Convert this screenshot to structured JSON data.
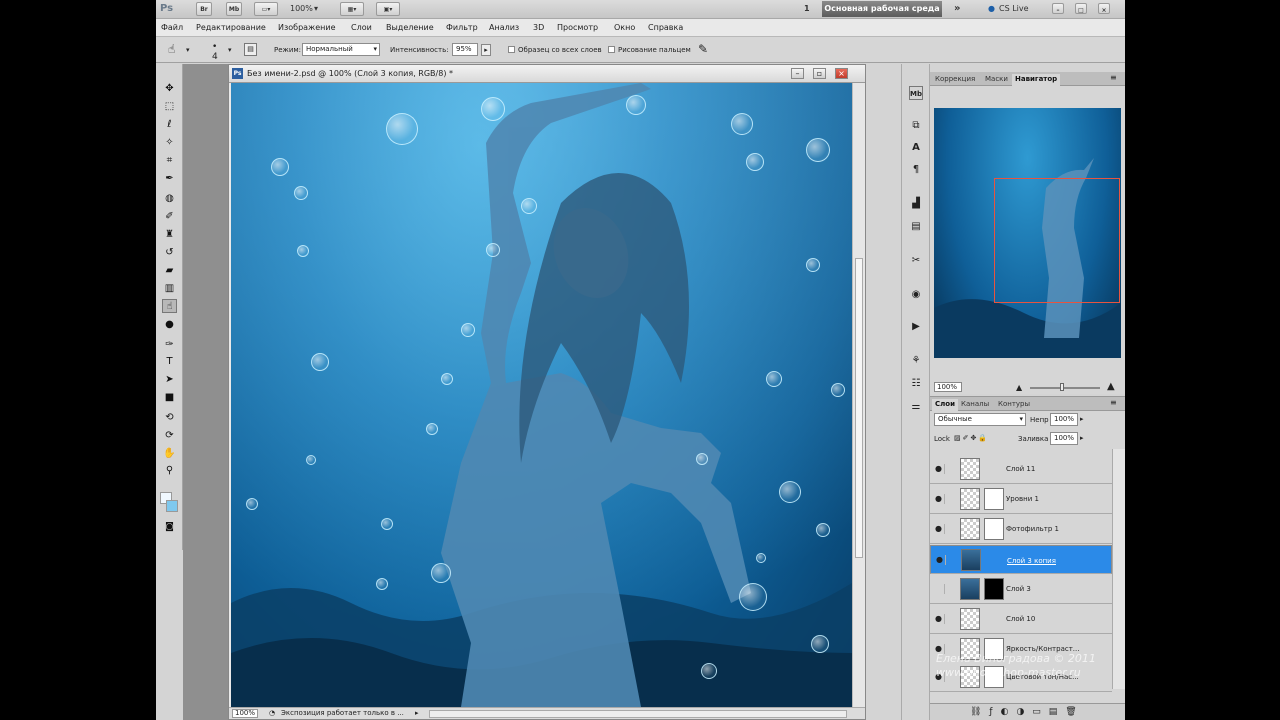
{
  "appbar": {
    "ps_logo": "Ps",
    "br": "Br",
    "mb": "Mb",
    "zoom": "100%",
    "one": "1",
    "workspace": "Основная рабочая среда",
    "cslive": "CS Live"
  },
  "menu": [
    "Файл",
    "Редактирование",
    "Изображение",
    "Слои",
    "Выделение",
    "Фильтр",
    "Анализ",
    "3D",
    "Просмотр",
    "Окно",
    "Справка"
  ],
  "options": {
    "mode_label": "Режим:",
    "mode_value": "Нормальный",
    "intensity_label": "Интенсивность:",
    "intensity_value": "95%",
    "sample_all": "Образец со всех слоев",
    "finger_paint": "Рисование пальцем"
  },
  "document": {
    "title": "Без имени-2.psd @ 100% (Слой 3 копия, RGB/8) *",
    "status_zoom": "100%",
    "status_text": "Экспозиция работает только в ..."
  },
  "panels": {
    "tabs_top": [
      "Коррекция",
      "Маски",
      "Навигатор"
    ],
    "nav_zoom": "100%",
    "tabs_layers": [
      "Слои",
      "Каналы",
      "Контуры"
    ],
    "blend": "Обычные",
    "opacity_label": "Непр",
    "opacity_value": "100%",
    "lock_label": "Lock",
    "fill_label": "Заливка",
    "fill_value": "100%"
  },
  "layers": [
    {
      "name": "Слой 11",
      "visible": true,
      "selected": false
    },
    {
      "name": "Уровни 1",
      "visible": true,
      "selected": false
    },
    {
      "name": "Фотофильтр 1",
      "visible": true,
      "selected": false
    },
    {
      "name": "Слой 3 копия",
      "visible": true,
      "selected": true
    },
    {
      "name": "Слой 3",
      "visible": false,
      "selected": false
    },
    {
      "name": "Слой 10",
      "visible": true,
      "selected": false
    },
    {
      "name": "Яркость/Контраст...",
      "visible": true,
      "selected": false
    },
    {
      "name": "Цветовой тон/Нас...",
      "visible": true,
      "selected": false
    }
  ],
  "watermark": {
    "line1": "Елена Виноградова © 2011",
    "line2": "www.photoshop-master.ru"
  },
  "colors": {
    "accent": "#2b8ae8",
    "workspace_bg": "#5c5c5c",
    "water": "#1a7cb8"
  },
  "icons": [
    "brush-tool-icon",
    "move-icon",
    "marquee-icon",
    "lasso-icon",
    "magic-wand-icon",
    "crop-icon",
    "eyedropper-icon",
    "healing-icon",
    "brush-icon",
    "stamp-icon",
    "history-brush-icon",
    "eraser-icon",
    "gradient-icon",
    "smudge-icon",
    "dodge-icon",
    "pen-icon",
    "type-icon",
    "path-select-icon",
    "shape-icon",
    "3d-rotate-icon",
    "3d-orbit-icon",
    "hand-icon",
    "zoom-icon",
    "eye-icon"
  ]
}
